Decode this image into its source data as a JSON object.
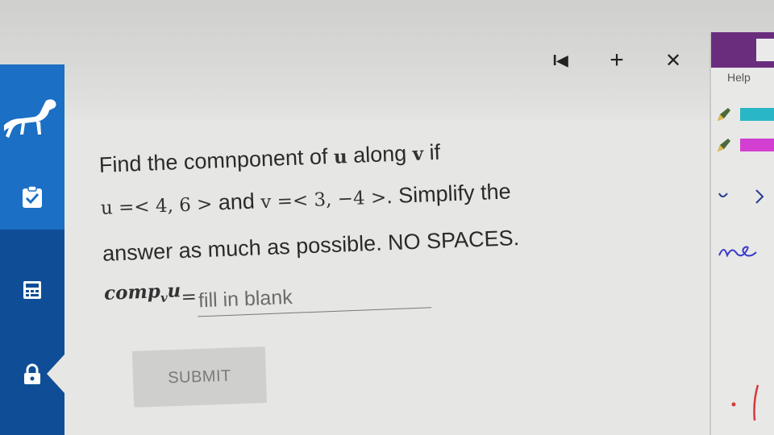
{
  "toolbar": {
    "first_label": "I◀",
    "add_label": "+",
    "close_label": "✕"
  },
  "question": {
    "line1_a": "Find the comnponent of ",
    "u": "u",
    "line1_b": " along ",
    "v": "v",
    "line1_c": " if",
    "u_def": "u =< 4, 6 >",
    "and_text": " and ",
    "v_def": "v =< 3, −4 >",
    "line2_end": ". Simplify the",
    "line3": "answer as much as possible. NO SPACES.",
    "comp_label": "comp",
    "comp_sub": "v",
    "comp_u": "u",
    "equals": " ="
  },
  "answer": {
    "value": "",
    "placeholder": "fill in blank"
  },
  "submit_label": "SUBMIT",
  "right_panel": {
    "help_label": "Help",
    "pen_colors": [
      "#29b6c5",
      "#d23fd1"
    ]
  },
  "colors": {
    "nav_blue": "#1b6fc4",
    "nav_dark": "#0f4e96",
    "panel_purple": "#6a2d7e"
  }
}
